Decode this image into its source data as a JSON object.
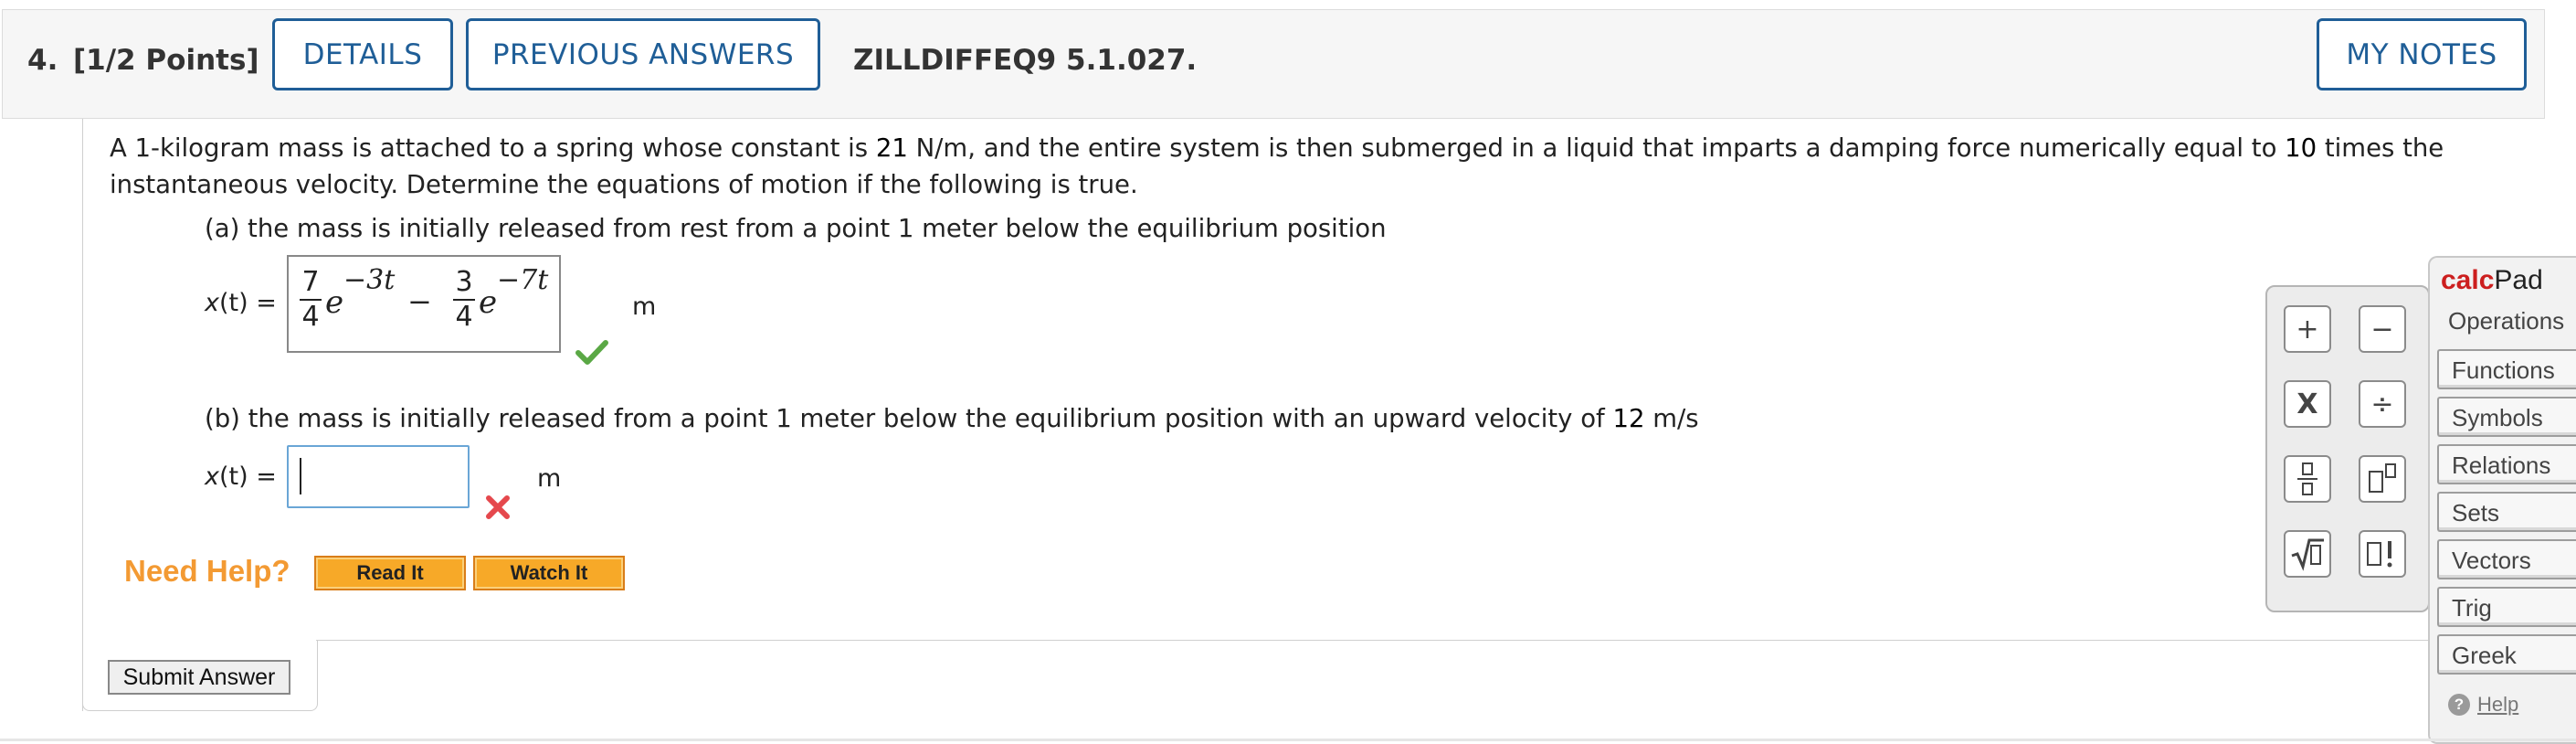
{
  "header": {
    "question_number": "4.",
    "points": "[1/2 Points]",
    "details_label": "DETAILS",
    "previous_answers_label": "PREVIOUS ANSWERS",
    "question_id": "ZILLDIFFEQ9 5.1.027.",
    "my_notes_label": "MY NOTES"
  },
  "problem": {
    "text_1": "A 1-kilogram mass is attached to a spring whose constant is ",
    "spring_constant": "21",
    "text_2": " N/m, and the entire system is then submerged in a liquid that imparts a damping force numerically equal to ",
    "damping": "10",
    "text_3": " times the instantaneous velocity. Determine the equations of motion if the following is true."
  },
  "part_a": {
    "prompt": "(a) the mass is initially released from rest from a point 1 meter below the equilibrium position",
    "label_x": "x",
    "label_t": "(t) =",
    "answer": {
      "coef1_num": "7",
      "coef1_den": "4",
      "base1": "e",
      "exp1": "−3t",
      "minus": "−",
      "coef2_num": "3",
      "coef2_den": "4",
      "base2": "e",
      "exp2": "−7t"
    },
    "unit": "m",
    "status": "correct",
    "status_color": "#5aa845"
  },
  "part_b": {
    "prompt_1": "(b) the mass is initially released from a point 1 meter below the equilibrium position with an upward velocity of ",
    "velocity": "12",
    "prompt_2": " m/s",
    "label_x": "x",
    "label_t": "(t) =",
    "answer_value": "",
    "unit": "m",
    "status": "incorrect",
    "status_color": "#e5484d"
  },
  "help": {
    "need_help": "Need Help?",
    "read_it": "Read It",
    "watch_it": "Watch It"
  },
  "submit_label": "Submit Answer",
  "calcpad": {
    "title_1": "calc",
    "title_2": "Pad",
    "operations": "Operations",
    "keys": [
      "+",
      "−",
      "X",
      "÷",
      "fraction",
      "exponent",
      "sqrt",
      "factorial"
    ],
    "menus": [
      "Functions",
      "Symbols",
      "Relations",
      "Sets",
      "Vectors",
      "Trig",
      "Greek"
    ],
    "help": "Help"
  },
  "colors": {
    "accent_blue": "#1f5e97",
    "need_help_orange": "#f39a33",
    "calc_red": "#cc1f1f"
  }
}
